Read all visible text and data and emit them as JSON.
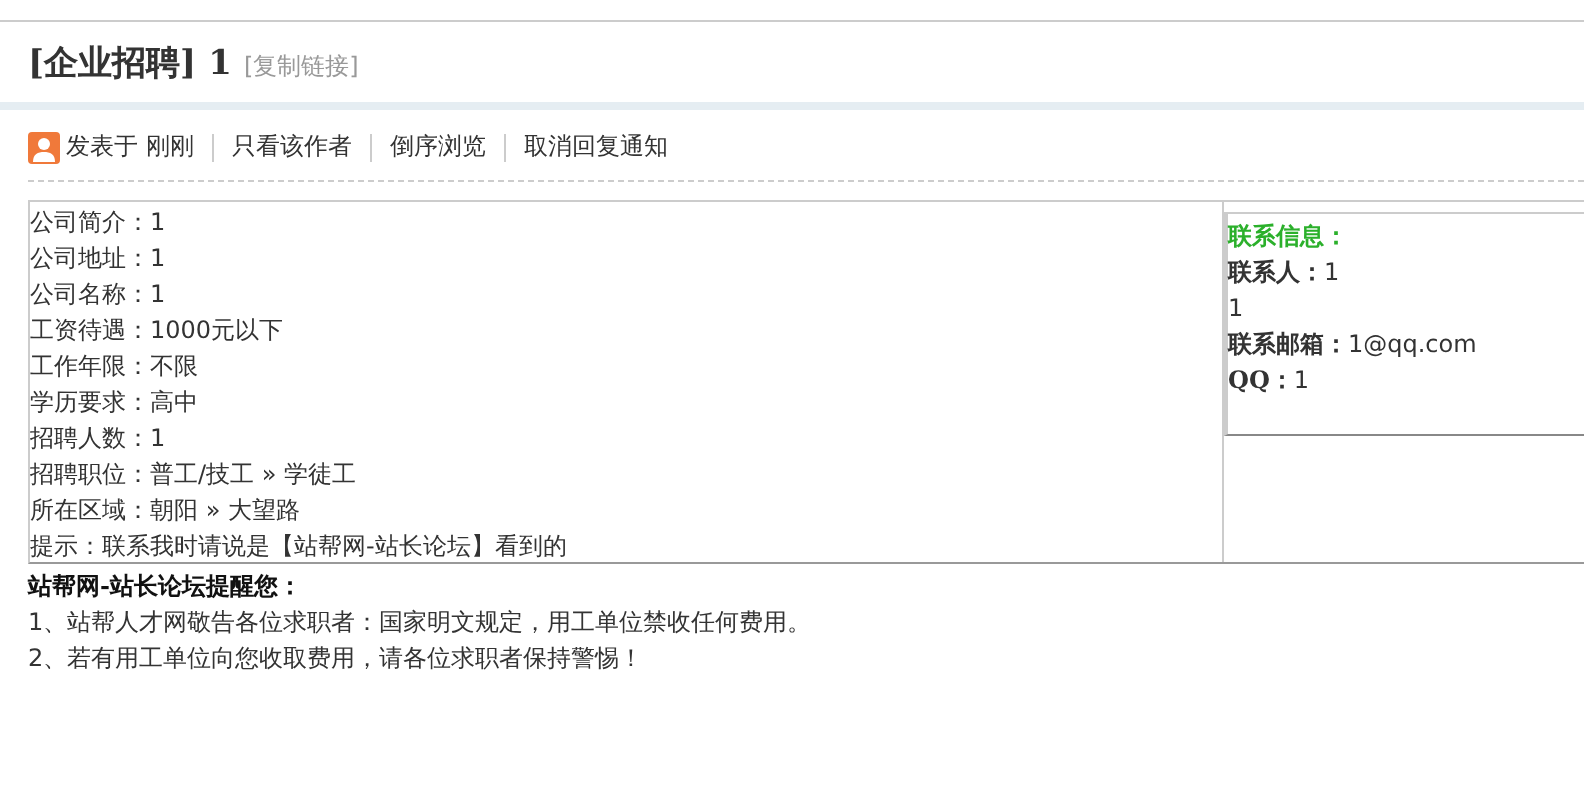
{
  "title": {
    "category": "[企业招聘]",
    "number": "1",
    "copy_link": "[复制链接]"
  },
  "post_actions": {
    "posted": "发表于 刚刚",
    "links": [
      "只看该作者",
      "倒序浏览",
      "取消回复通知"
    ]
  },
  "fields": [
    {
      "label": "公司简介：",
      "value": "1"
    },
    {
      "label": "公司地址：",
      "value": "1"
    },
    {
      "label": "公司名称：",
      "value": "1"
    },
    {
      "label": "工资待遇：",
      "value": "1000元以下"
    },
    {
      "label": "工作年限：",
      "value": "不限"
    },
    {
      "label": "学历要求：",
      "value": "高中"
    },
    {
      "label": "招聘人数：",
      "value": "1"
    },
    {
      "label": "招聘职位：",
      "value": "普工/技工 » 学徒工"
    },
    {
      "label": "所在区域：",
      "value": "朝阳 » 大望路"
    },
    {
      "label": "提示：",
      "value": "联系我时请说是【站帮网-站长论坛】看到的"
    }
  ],
  "contact": {
    "heading": "联系信息：",
    "lines": [
      {
        "label": "联系人：",
        "value": "1"
      },
      {
        "value": "1"
      },
      {
        "label": "联系邮箱：",
        "value": "1@qq.com"
      },
      {
        "label": "QQ：",
        "value": "1"
      }
    ]
  },
  "notice": {
    "heading": "站帮网-站长论坛提醒您：",
    "items": [
      "1、站帮人才网敬告各位求职者：国家明文规定，用工单位禁收任何费用。",
      "2、若有用工单位向您收取费用，请各位求职者保持警惕！"
    ]
  }
}
